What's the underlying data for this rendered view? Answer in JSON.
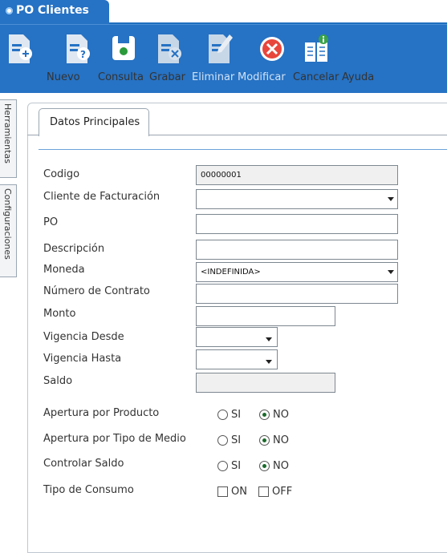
{
  "app": {
    "title": "PO Clientes"
  },
  "toolbar": {
    "buttons": [
      {
        "label": "Nuevo",
        "icon": "doc-add-icon",
        "enabled": true
      },
      {
        "label": "Consulta",
        "icon": "doc-question-icon",
        "enabled": true
      },
      {
        "label": "Grabar",
        "icon": "save-icon",
        "enabled": true
      },
      {
        "label": "Eliminar",
        "icon": "doc-delete-icon",
        "enabled": false
      },
      {
        "label": "Modificar",
        "icon": "doc-edit-icon",
        "enabled": false
      },
      {
        "label": "Cancelar",
        "icon": "cancel-icon",
        "enabled": true
      },
      {
        "label": "Ayuda",
        "icon": "help-book-icon",
        "enabled": true
      }
    ]
  },
  "sidetabs": [
    "Herramientas",
    "Configuraciones"
  ],
  "form": {
    "tab": "Datos Principales",
    "labels": {
      "codigo": "Codigo",
      "cliente": "Cliente de Facturación",
      "po": "PO",
      "descripcion": "Descripción",
      "moneda": "Moneda",
      "contrato": "Número de Contrato",
      "monto": "Monto",
      "desde": "Vigencia Desde",
      "hasta": "Vigencia Hasta",
      "saldo": "Saldo",
      "apertura_producto": "Apertura por Producto",
      "apertura_medio": "Apertura por Tipo de Medio",
      "controlar_saldo": "Controlar Saldo",
      "tipo_consumo": "Tipo de Consumo"
    },
    "values": {
      "codigo": "00000001",
      "cliente": "",
      "po": "",
      "descripcion": "",
      "moneda": "<INDEFINIDA>",
      "contrato": "",
      "monto": "",
      "desde": "",
      "hasta": "",
      "saldo": ""
    },
    "radio_labels": {
      "si": "SI",
      "no": "NO"
    },
    "check_labels": {
      "on": "ON",
      "off": "OFF"
    },
    "selected": {
      "apertura_producto": "NO",
      "apertura_medio": "NO",
      "controlar_saldo": "NO"
    },
    "colors": {
      "accent": "#2672c4",
      "radio_selected": "#1a6a2a"
    }
  }
}
